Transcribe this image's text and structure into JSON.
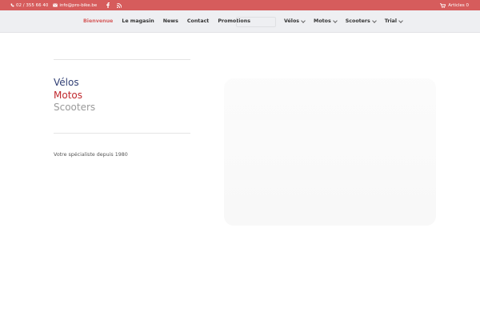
{
  "topbar": {
    "phone": "02 / 355 66 40",
    "email": "info@pro-bike.be",
    "cart_label": "Articles 0",
    "icons": [
      "phone-icon",
      "mail-icon",
      "facebook-icon",
      "rss-icon",
      "cart-icon"
    ]
  },
  "nav": {
    "left": [
      {
        "label": "Bienvenue",
        "active": true
      },
      {
        "label": "Le magasin"
      },
      {
        "label": "News"
      },
      {
        "label": "Contact"
      },
      {
        "label": "Promotions"
      }
    ],
    "right": [
      {
        "label": "Vélos"
      },
      {
        "label": "Motos"
      },
      {
        "label": "Scooters"
      },
      {
        "label": "Trial"
      }
    ]
  },
  "hero": {
    "line1": "Vélos",
    "line2": "Motos",
    "line3": "Scooters",
    "tagline": "Votre spécialiste depuis 1980"
  },
  "colors": {
    "accent": "#d65c5c",
    "velos": "#2f3e74",
    "motos": "#c0282d",
    "scooters": "#9a9a9a"
  }
}
